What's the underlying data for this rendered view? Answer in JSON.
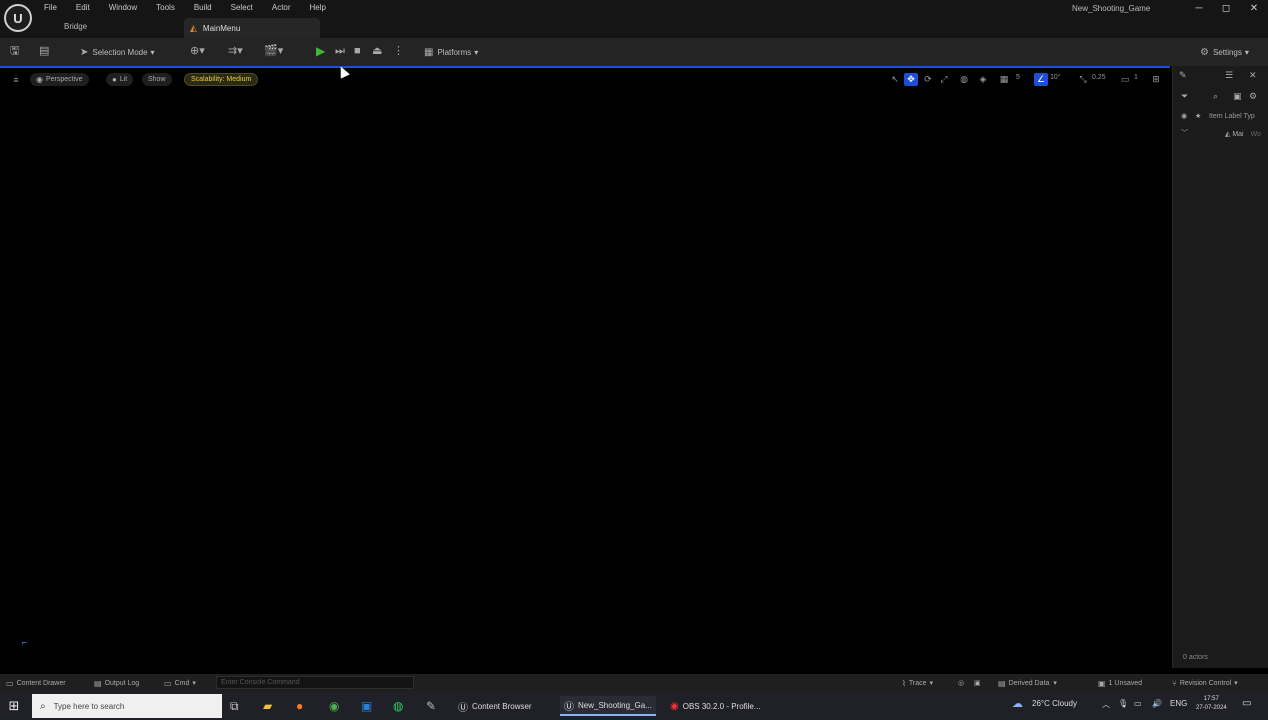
{
  "menubar": [
    "File",
    "Edit",
    "Window",
    "Tools",
    "Build",
    "Select",
    "Actor",
    "Help"
  ],
  "bridge_label": "Bridge",
  "level_tab": "MainMenu",
  "project_name": "New_Shooting_Game",
  "window_controls": {
    "minimize": "─",
    "maximize": "◻",
    "close": "✕"
  },
  "toolbar": {
    "selection_mode": "Selection Mode",
    "platforms": "Platforms",
    "settings": "Settings"
  },
  "viewport": {
    "perspective": "Perspective",
    "lit": "Lit",
    "show": "Show",
    "scalability": "Scalability: Medium",
    "grid_snap": "5",
    "rotation_snap": "10°",
    "scale_snap": "0.25",
    "camera_speed": "1"
  },
  "outliner": {
    "header": "Item Label Typ",
    "row_label": "Mai",
    "row_type": "Wo",
    "actors": "0 actors"
  },
  "statusbar": {
    "content_drawer": "Content Drawer",
    "output_log": "Output Log",
    "cmd": "Cmd",
    "console_placeholder": "Enter Console Command",
    "trace": "Trace",
    "derived_data": "Derived Data",
    "unsaved": "1 Unsaved",
    "revision_control": "Revision Control"
  },
  "taskbar": {
    "search_placeholder": "Type here to search",
    "windows": [
      "Content Browser",
      "New_Shooting_Ga...",
      "OBS 30.2.0 - Profile..."
    ],
    "weather": "26°C  Cloudy",
    "language": "ENG",
    "time": "17:57",
    "date": "27-07-2024"
  },
  "colors": {
    "accent_blue": "#1c4fd6",
    "play_green": "#3cb93c",
    "scalability_yellow": "#e6c84a",
    "level_orange": "#e08a1e"
  }
}
